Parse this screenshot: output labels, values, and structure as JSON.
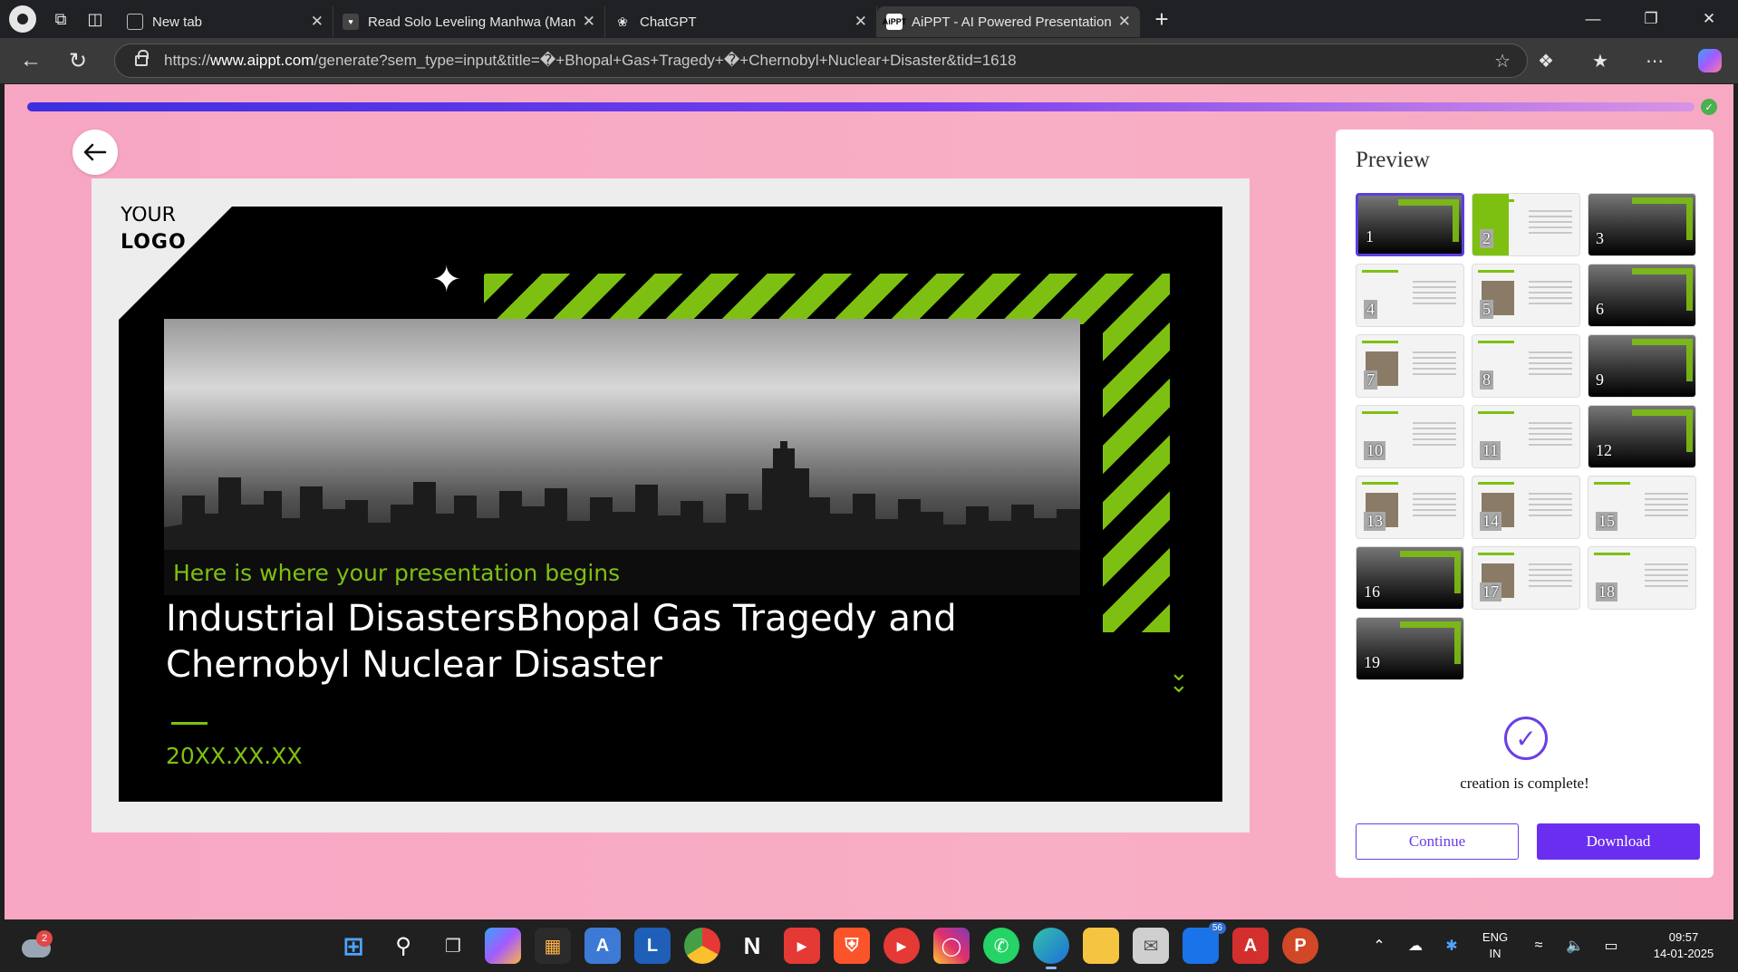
{
  "browser": {
    "tabs": [
      {
        "label": "New tab",
        "active": false,
        "favicon": "new-tab-icon"
      },
      {
        "label": "Read Solo Leveling Manhwa (Man",
        "active": false,
        "favicon": "manga-site-icon"
      },
      {
        "label": "ChatGPT",
        "active": false,
        "favicon": "chatgpt-icon"
      },
      {
        "label": "AiPPT - AI Powered Presentation T",
        "active": true,
        "favicon": "aippt-icon"
      }
    ],
    "url_prefix": "https://",
    "url_host": "www.aippt.com",
    "url_path": "/generate?sem_type=input&title=�+Bhopal+Gas+Tragedy+�+Chernobyl+Nuclear+Disaster&tid=1618"
  },
  "page": {
    "progress_fraction": 1.0,
    "slide": {
      "logo_line1": "YOUR",
      "logo_line2": "LOGO",
      "subtitle": "Here is where your presentation begins",
      "title": "Industrial DisastersBhopal Gas Tragedy and Chernobyl Nuclear Disaster",
      "date": "20XX.XX.XX"
    },
    "preview": {
      "heading": "Preview",
      "thumbnails": [
        {
          "n": "1",
          "style": "dark",
          "selected": true
        },
        {
          "n": "2",
          "style": "green-contents",
          "selected": false
        },
        {
          "n": "3",
          "style": "dark",
          "selected": false
        },
        {
          "n": "4",
          "style": "light",
          "selected": false
        },
        {
          "n": "5",
          "style": "light-photo",
          "selected": false
        },
        {
          "n": "6",
          "style": "dark",
          "selected": false
        },
        {
          "n": "7",
          "style": "light-photo",
          "selected": false
        },
        {
          "n": "8",
          "style": "light",
          "selected": false
        },
        {
          "n": "9",
          "style": "dark",
          "selected": false
        },
        {
          "n": "10",
          "style": "light",
          "selected": false
        },
        {
          "n": "11",
          "style": "light",
          "selected": false
        },
        {
          "n": "12",
          "style": "dark",
          "selected": false
        },
        {
          "n": "13",
          "style": "light-photo",
          "selected": false
        },
        {
          "n": "14",
          "style": "light-photo",
          "selected": false
        },
        {
          "n": "15",
          "style": "light",
          "selected": false
        },
        {
          "n": "16",
          "style": "dark",
          "selected": false
        },
        {
          "n": "17",
          "style": "light-photo",
          "selected": false
        },
        {
          "n": "18",
          "style": "light",
          "selected": false
        },
        {
          "n": "19",
          "style": "dark",
          "selected": false
        }
      ],
      "status": "creation is complete!",
      "continue_label": "Continue",
      "download_label": "Download"
    }
  },
  "taskbar": {
    "weather_badge": "2",
    "outlook_badge": "56",
    "lang_line1": "ENG",
    "lang_line2": "IN",
    "time": "09:57",
    "date": "14-01-2025"
  },
  "colors": {
    "accent_green": "#7ec012",
    "brand_purple": "#6a2ef0",
    "page_pink": "#f7a6c4"
  }
}
